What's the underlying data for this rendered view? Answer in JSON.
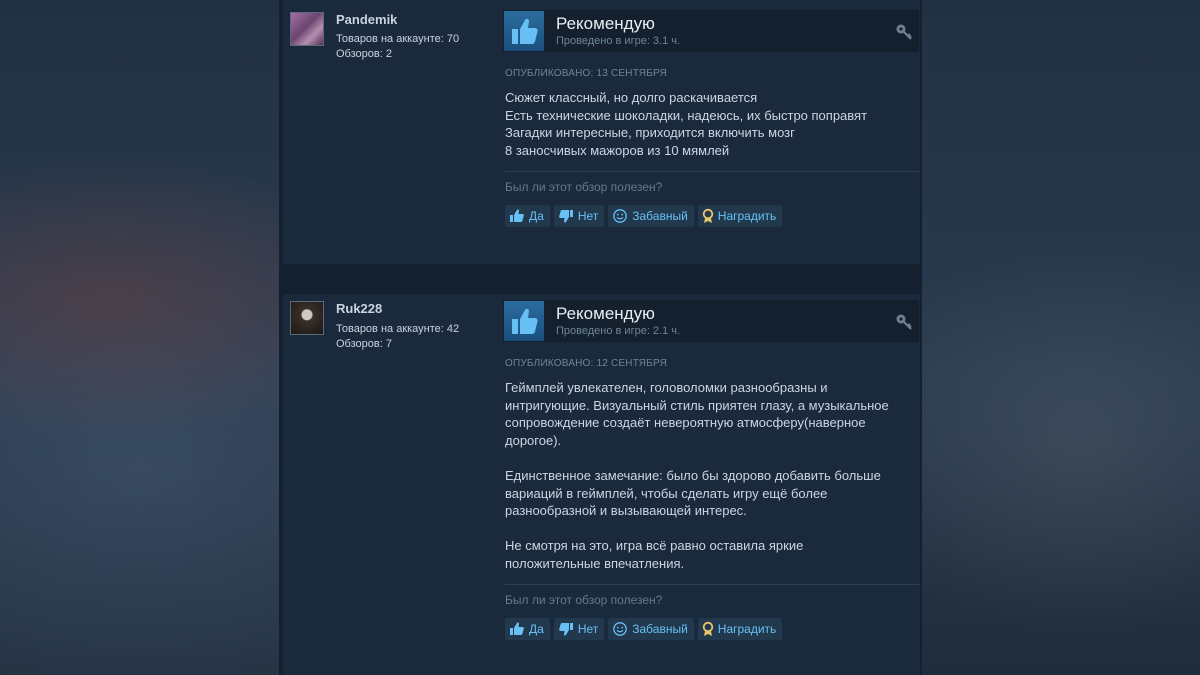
{
  "reviews": [
    {
      "user": {
        "name": "Pandemik",
        "products": "Товаров на аккаунте: 70",
        "reviews": "Обзоров: 2"
      },
      "verdict": "Рекомендую",
      "playtime": "Проведено в игре: 3.1 ч.",
      "posted": "ОПУБЛИКОВАНО: 13 СЕНТЯБРЯ",
      "text": "Сюжет классный, но долго раскачивается\nЕсть технические шоколадки, надеюсь, их быстро поправят\nЗагадки интересные, приходится включить мозг\n8 заносчивых мажоров из 10 мямлей",
      "helpful_prompt": "Был ли этот обзор полезен?",
      "buttons": {
        "yes": "Да",
        "no": "Нет",
        "funny": "Забавный",
        "award": "Наградить"
      }
    },
    {
      "user": {
        "name": "Ruk228",
        "products": "Товаров на аккаунте: 42",
        "reviews": "Обзоров: 7"
      },
      "verdict": "Рекомендую",
      "playtime": "Проведено в игре: 2.1 ч.",
      "posted": "ОПУБЛИКОВАНО: 12 СЕНТЯБРЯ",
      "text": "Геймплей увлекателен, головоломки разнообразны и\nинтригующие. Визуальный стиль приятен глазу, а музыкальное\nсопровождение создаёт невероятную атмосферу(наверное\nдорогое).\n\nЕдинственное замечание: было бы здорово добавить больше\nвариаций в геймплей, чтобы сделать игру ещё более\nразнообразной и вызывающей интерес.\n\nНе смотря на это, игра всё равно оставила яркие\nположительные впечатления.",
      "helpful_prompt": "Был ли этот обзор полезен?",
      "buttons": {
        "yes": "Да",
        "no": "Нет",
        "funny": "Забавный",
        "award": "Наградить"
      }
    }
  ],
  "icons": {
    "recommend": "thumbs-up-icon",
    "award_key": "key-icon",
    "yes": "thumbs-up-icon",
    "no": "thumbs-down-icon",
    "funny": "smiley-icon",
    "award": "ribbon-icon"
  },
  "colors": {
    "page_bg": "#1b2838",
    "card_bg": "#1a2a3c",
    "thumb_box": "#1a4f7c",
    "button_bg": "#22384d",
    "button_text": "#67c1f5",
    "award_gold": "#e8c66a"
  }
}
